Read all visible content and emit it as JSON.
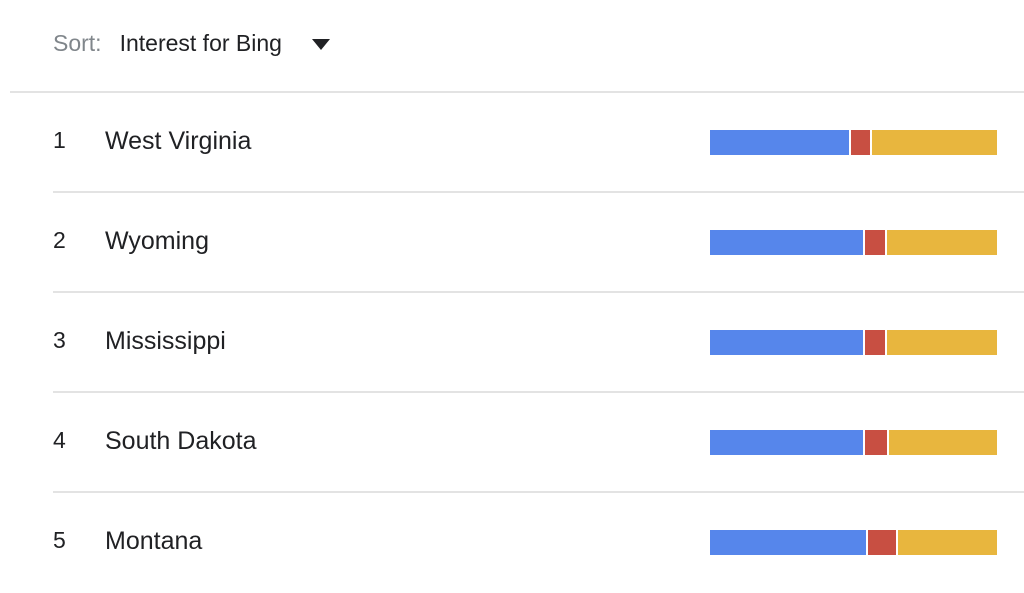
{
  "sort": {
    "label": "Sort:",
    "value": "Interest for Bing"
  },
  "colors": {
    "series_1": "#5686eb",
    "series_2": "#c84f42",
    "series_3": "#e8b63e"
  },
  "rows": [
    {
      "rank": "1",
      "name": "West Virginia",
      "shares": [
        49,
        7,
        44
      ]
    },
    {
      "rank": "2",
      "name": "Wyoming",
      "shares": [
        54,
        7,
        39
      ]
    },
    {
      "rank": "3",
      "name": "Mississippi",
      "shares": [
        54,
        7,
        39
      ]
    },
    {
      "rank": "4",
      "name": "South Dakota",
      "shares": [
        54,
        8,
        38
      ]
    },
    {
      "rank": "5",
      "name": "Montana",
      "shares": [
        55,
        10,
        35
      ]
    }
  ]
}
